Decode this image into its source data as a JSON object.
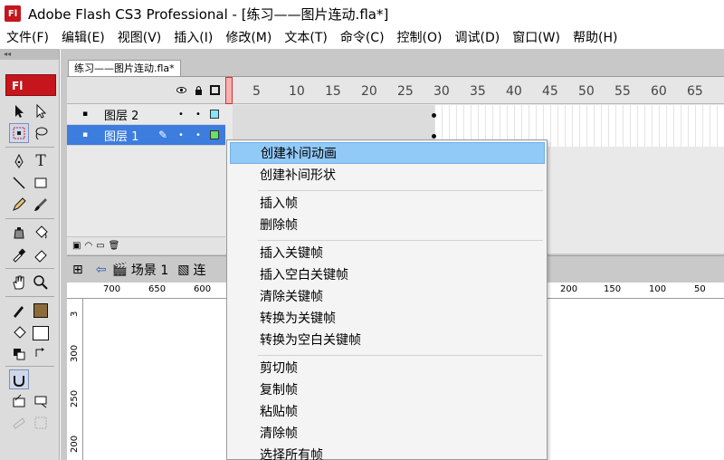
{
  "window": {
    "title": "Adobe Flash CS3 Professional - [练习——图片连动.fla*]",
    "icon_text": "Fl"
  },
  "menubar": {
    "items": [
      "文件(F)",
      "编辑(E)",
      "视图(V)",
      "插入(I)",
      "修改(M)",
      "文本(T)",
      "命令(C)",
      "控制(O)",
      "调试(D)",
      "窗口(W)",
      "帮助(H)"
    ]
  },
  "toolbox": {
    "logo": "Fl",
    "collapse": "◂◂"
  },
  "document": {
    "tab_label": "练习——图片连动.fla*"
  },
  "timeline": {
    "frame_numbers": [
      "5",
      "10",
      "15",
      "20",
      "25",
      "30",
      "35",
      "40",
      "45",
      "50",
      "55",
      "60",
      "65"
    ],
    "layers": [
      {
        "name": "图层 2",
        "selected": false
      },
      {
        "name": "图层 1",
        "selected": true
      }
    ]
  },
  "scene_bar": {
    "scene": "场景 1",
    "symbol": "连"
  },
  "ruler": {
    "h_left": [
      "700",
      "650",
      "600"
    ],
    "h_right": [
      "200",
      "150",
      "100",
      "50"
    ],
    "v_marks": [
      "3",
      "300",
      "250",
      "200"
    ]
  },
  "context_menu": {
    "groups": [
      [
        "创建补间动画",
        "创建补间形状"
      ],
      [
        "插入帧",
        "删除帧"
      ],
      [
        "插入关键帧",
        "插入空白关键帧",
        "清除关键帧",
        "转换为关键帧",
        "转换为空白关键帧"
      ],
      [
        "剪切帧",
        "复制帧",
        "粘贴帧",
        "清除帧",
        "选择所有帧"
      ]
    ],
    "hovered_index": 0
  },
  "colors": {
    "accent": "#c4161c",
    "selection": "#3c7dde",
    "menu_hover": "#91c9f7"
  }
}
